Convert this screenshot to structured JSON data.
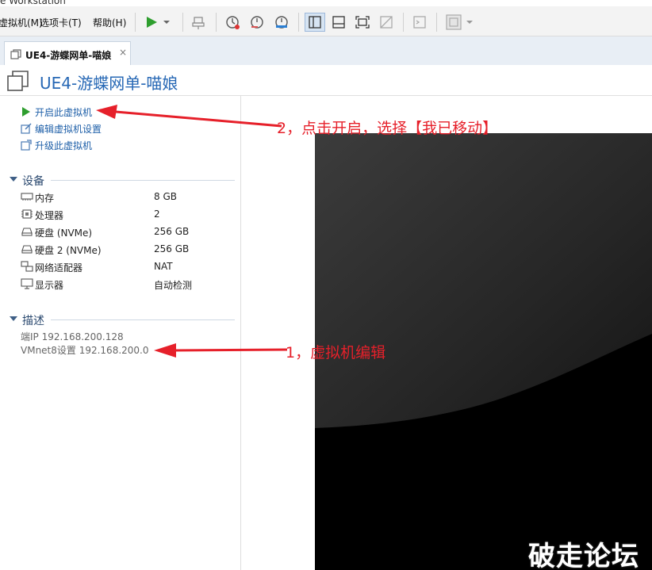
{
  "window": {
    "title_fragment": "e Workstation"
  },
  "menu": {
    "items": [
      {
        "label": "虚拟机(M)"
      },
      {
        "label": "选项卡(T)"
      },
      {
        "label": "帮助(H)"
      }
    ]
  },
  "toolbar": {
    "icons": [
      "play-icon",
      "dropdown-icon",
      "send-keys-icon",
      "snapshot-icon",
      "revert-snapshot-icon",
      "manage-snapshots-icon",
      "library-view-icon",
      "thumbnail-view-icon",
      "fullscreen-icon",
      "unity-icon",
      "console-icon",
      "stretch-icon"
    ]
  },
  "tab": {
    "label": "UE4-游蝶网单-喵娘",
    "close": "×"
  },
  "vm": {
    "title": "UE4-游蝶网单-喵娘"
  },
  "actions": [
    {
      "label": "开启此虚拟机",
      "icon": "play-icon"
    },
    {
      "label": "编辑虚拟机设置",
      "icon": "edit-settings-icon"
    },
    {
      "label": "升级此虚拟机",
      "icon": "upgrade-icon"
    }
  ],
  "devices": {
    "title": "设备",
    "items": [
      {
        "name": "内存",
        "value": "8 GB",
        "icon": "memory-icon"
      },
      {
        "name": "处理器",
        "value": "2",
        "icon": "cpu-icon"
      },
      {
        "name": "硬盘 (NVMe)",
        "value": "256 GB",
        "icon": "disk-icon"
      },
      {
        "name": "硬盘 2 (NVMe)",
        "value": "256 GB",
        "icon": "disk-icon"
      },
      {
        "name": "网络适配器",
        "value": "NAT",
        "icon": "network-icon"
      },
      {
        "name": "显示器",
        "value": "自动检测",
        "icon": "monitor-icon"
      }
    ]
  },
  "description": {
    "title": "描述",
    "lines": [
      "端IP 192.168.200.128",
      "VMnet8设置 192.168.200.0"
    ]
  },
  "annotations": {
    "step2": "2，点击开启，选择【我已移动】",
    "step1": "1，虚拟机编辑",
    "color": "#e6202a"
  },
  "watermark": "破走论坛",
  "colors": {
    "accent": "#2768b5",
    "link": "#1e5fa8",
    "play_green": "#2e9e2e"
  }
}
